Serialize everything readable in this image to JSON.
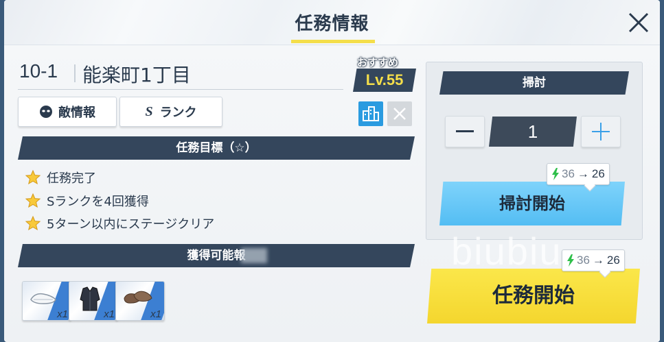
{
  "header": {
    "title": "任務情報"
  },
  "stage": {
    "code": "10-1",
    "name": "能楽町1丁目"
  },
  "recommend": {
    "label": "おすすめ",
    "level": "Lv.55"
  },
  "tabs": {
    "enemy_label": "敵情報",
    "rank_label": "ランク",
    "rank_prefix": "S"
  },
  "goals": {
    "title": "任務目標（☆）",
    "items": [
      "任務完了",
      "Sランクを4回獲得",
      "5ターン以内にステージクリア"
    ]
  },
  "rewards": {
    "title": "獲得可能報",
    "items": [
      {
        "icon": "shoes-icon",
        "qty": "x1"
      },
      {
        "icon": "jacket-icon",
        "qty": "x1"
      },
      {
        "icon": "boots-icon",
        "qty": "x1"
      }
    ]
  },
  "sweep": {
    "title": "掃討",
    "quantity": "1",
    "cost_from": "36",
    "cost_to": "26",
    "start_label": "掃討開始"
  },
  "mission": {
    "cost_from": "36",
    "cost_to": "26",
    "start_label": "任務開始"
  },
  "watermark": "biubiu",
  "colors": {
    "accent_yellow": "#f4de4a",
    "banner_navy": "#34465c",
    "sweep_blue": "#53bdf3",
    "energy_green": "#2fbf4a"
  }
}
